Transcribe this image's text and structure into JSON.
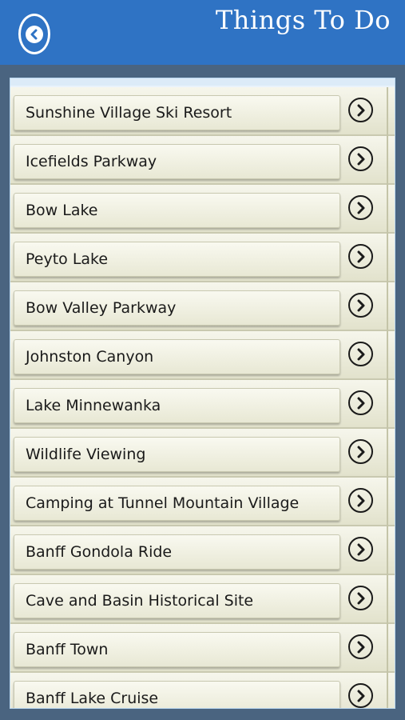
{
  "header": {
    "title": "Things To Do",
    "back_icon": "back-arrow-icon",
    "bg_color": "#2f73c4"
  },
  "list": {
    "items": [
      {
        "label": "Sunshine Village Ski Resort"
      },
      {
        "label": "Icefields Parkway"
      },
      {
        "label": "Bow Lake"
      },
      {
        "label": "Peyto Lake"
      },
      {
        "label": "Bow Valley Parkway"
      },
      {
        "label": "Johnston Canyon"
      },
      {
        "label": "Lake Minnewanka"
      },
      {
        "label": " Wildlife Viewing"
      },
      {
        "label": "Camping at Tunnel Mountain Village"
      },
      {
        "label": "Banff Gondola Ride"
      },
      {
        "label": "Cave and Basin Historical Site"
      },
      {
        "label": "Banff Town"
      },
      {
        "label": "Banff Lake Cruise"
      }
    ],
    "chevron_icon": "chevron-right-circle-icon"
  }
}
